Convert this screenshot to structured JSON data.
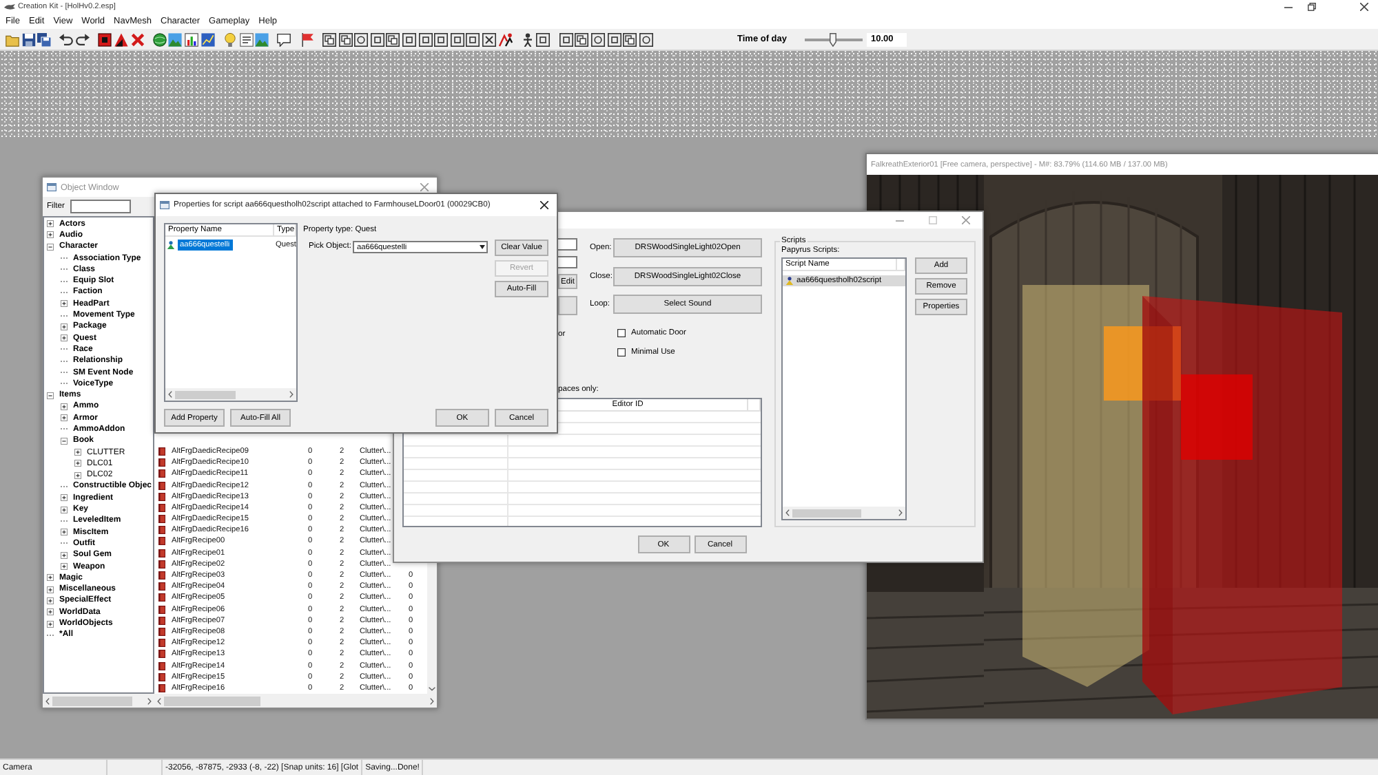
{
  "app_window": {
    "title": "Creation Kit - [HolHv0.2.esp]"
  },
  "menu": [
    "File",
    "Edit",
    "View",
    "World",
    "NavMesh",
    "Character",
    "Gameplay",
    "Help"
  ],
  "toolbar": {
    "time_of_day": {
      "label": "Time of day",
      "level": 0.48,
      "value": "10.00"
    }
  },
  "render_window": {
    "title": "FalkreathExterior01 [Free camera, perspective] - M#: 83.79% (114.60 MB / 137.00 MB)"
  },
  "object_window": {
    "title": "Object Window",
    "filter": {
      "label": "Filter"
    },
    "tree": [
      {
        "label": "Actors",
        "expanded": false
      },
      {
        "label": "Audio",
        "expanded": false
      },
      {
        "label": "Character",
        "expanded": true,
        "children": [
          {
            "label": "Association Type"
          },
          {
            "label": "Class"
          },
          {
            "label": "Equip Slot"
          },
          {
            "label": "Faction"
          },
          {
            "label": "HeadPart",
            "expanded": false
          },
          {
            "label": "Movement Type"
          },
          {
            "label": "Package",
            "expanded": false
          },
          {
            "label": "Quest",
            "expanded": false
          },
          {
            "label": "Race"
          },
          {
            "label": "Relationship"
          },
          {
            "label": "SM Event Node"
          },
          {
            "label": "VoiceType"
          }
        ]
      },
      {
        "label": "Items",
        "expanded": true,
        "children": [
          {
            "label": "Ammo",
            "expanded": false
          },
          {
            "label": "Armor",
            "expanded": false
          },
          {
            "label": "AmmoAddon"
          },
          {
            "label": "Book",
            "expanded": true,
            "children": [
              {
                "label": "CLUTTER",
                "expanded": false
              },
              {
                "label": "DLC01",
                "expanded": false
              },
              {
                "label": "DLC02",
                "expanded": false
              }
            ]
          },
          {
            "label": "Constructible Objec"
          },
          {
            "label": "Ingredient",
            "expanded": false
          },
          {
            "label": "Key",
            "expanded": false
          },
          {
            "label": "LeveledItem"
          },
          {
            "label": "MiscItem",
            "expanded": false
          },
          {
            "label": "Outfit"
          },
          {
            "label": "Soul Gem",
            "expanded": false
          },
          {
            "label": "Weapon",
            "expanded": false
          }
        ]
      },
      {
        "label": "Magic",
        "expanded": false
      },
      {
        "label": "Miscellaneous",
        "expanded": false
      },
      {
        "label": "SpecialEffect",
        "expanded": false
      },
      {
        "label": "WorldData",
        "expanded": false
      },
      {
        "label": "WorldObjects",
        "expanded": false
      },
      {
        "label": "*All"
      }
    ],
    "rows": [
      {
        "cells": [
          "AltFrgDaedicRecipe09",
          "0",
          "2",
          "Clutter\\..."
        ]
      },
      {
        "cells": [
          "AltFrgDaedicRecipe10",
          "0",
          "2",
          "Clutter\\..."
        ]
      },
      {
        "cells": [
          "AltFrgDaedicRecipe11",
          "0",
          "2",
          "Clutter\\..."
        ]
      },
      {
        "cells": [
          "AltFrgDaedicRecipe12",
          "0",
          "2",
          "Clutter\\..."
        ]
      },
      {
        "cells": [
          "AltFrgDaedicRecipe13",
          "0",
          "2",
          "Clutter\\..."
        ]
      },
      {
        "cells": [
          "AltFrgDaedicRecipe14",
          "0",
          "2",
          "Clutter\\..."
        ]
      },
      {
        "cells": [
          "AltFrgDaedicRecipe15",
          "0",
          "2",
          "Clutter\\..."
        ]
      },
      {
        "cells": [
          "AltFrgDaedicRecipe16",
          "0",
          "2",
          "Clutter\\..."
        ]
      },
      {
        "cells": [
          "AltFrgRecipe00",
          "0",
          "2",
          "Clutter\\..."
        ]
      },
      {
        "cells": [
          "AltFrgRecipe01",
          "0",
          "2",
          "Clutter\\..."
        ]
      },
      {
        "cells": [
          "AltFrgRecipe02",
          "0",
          "2",
          "Clutter\\..."
        ]
      },
      {
        "cells": [
          "AltFrgRecipe03",
          "0",
          "2",
          "Clutter\\...",
          "0"
        ]
      },
      {
        "cells": [
          "AltFrgRecipe04",
          "0",
          "2",
          "Clutter\\...",
          "0"
        ]
      },
      {
        "cells": [
          "AltFrgRecipe05",
          "0",
          "2",
          "Clutter\\...",
          "0"
        ]
      },
      {
        "cells": [
          "AltFrgRecipe06",
          "0",
          "2",
          "Clutter\\...",
          "0"
        ]
      },
      {
        "cells": [
          "AltFrgRecipe07",
          "0",
          "2",
          "Clutter\\...",
          "0"
        ]
      },
      {
        "cells": [
          "AltFrgRecipe08",
          "0",
          "2",
          "Clutter\\...",
          "0"
        ]
      },
      {
        "cells": [
          "AltFrgRecipe12",
          "0",
          "2",
          "Clutter\\...",
          "0"
        ]
      },
      {
        "cells": [
          "AltFrgRecipe13",
          "0",
          "2",
          "Clutter\\...",
          "0"
        ]
      },
      {
        "cells": [
          "AltFrgRecipe14",
          "0",
          "2",
          "Clutter\\...",
          "0"
        ]
      },
      {
        "cells": [
          "AltFrgRecipe15",
          "0",
          "2",
          "Clutter\\...",
          "0"
        ]
      },
      {
        "cells": [
          "AltFrgRecipe16",
          "0",
          "2",
          "Clutter\\...",
          "0"
        ]
      }
    ]
  },
  "door_dialog": {
    "edit_button": "Edit",
    "option_fragment": "or",
    "sounds": [
      {
        "label": "Open:",
        "button": "DRSWoodSingleLight02Open"
      },
      {
        "label": "Close:",
        "button": "DRSWoodSingleLight02Close"
      },
      {
        "label": "Loop:",
        "button": "Select Sound"
      }
    ],
    "checkboxes": [
      {
        "label": "Automatic Door",
        "checked": false
      },
      {
        "label": "Minimal Use",
        "checked": false
      }
    ],
    "table_caption": "paces only:",
    "table": {
      "column_2": "Editor ID"
    },
    "scripts": {
      "title": "Scripts",
      "caption": "Papyrus Scripts:",
      "column": "Script Name",
      "rows": [
        {
          "name": "aa666questholh02script",
          "selected": true
        }
      ],
      "buttons": [
        "Add",
        "Remove",
        "Properties"
      ]
    },
    "buttons": [
      "OK",
      "Cancel"
    ]
  },
  "properties_dialog": {
    "title": "Properties for script aa666questholh02script attached to FarmhouseLDoor01 (00029CB0)",
    "columns": [
      "Property Name",
      "Type"
    ],
    "rows": [
      {
        "name": "aa666questelli",
        "type": "Quest",
        "selected": true
      }
    ],
    "property_type": "Property type: Quest",
    "pick_object": {
      "label": "Pick Object:",
      "value": "aa666questelli"
    },
    "side_buttons": [
      {
        "label": "Clear Value",
        "disabled": false
      },
      {
        "label": "Revert",
        "disabled": true
      },
      {
        "label": "Auto-Fill",
        "disabled": false
      }
    ],
    "left_buttons": [
      "Add Property",
      "Auto-Fill All"
    ],
    "buttons": [
      "OK",
      "Cancel"
    ]
  },
  "status_bar": {
    "mode": "Camera",
    "coordinates": "-32056, -87875, -2933 (-8, -22) [Snap units: 16] [Glot",
    "message": "Saving...Done!"
  }
}
